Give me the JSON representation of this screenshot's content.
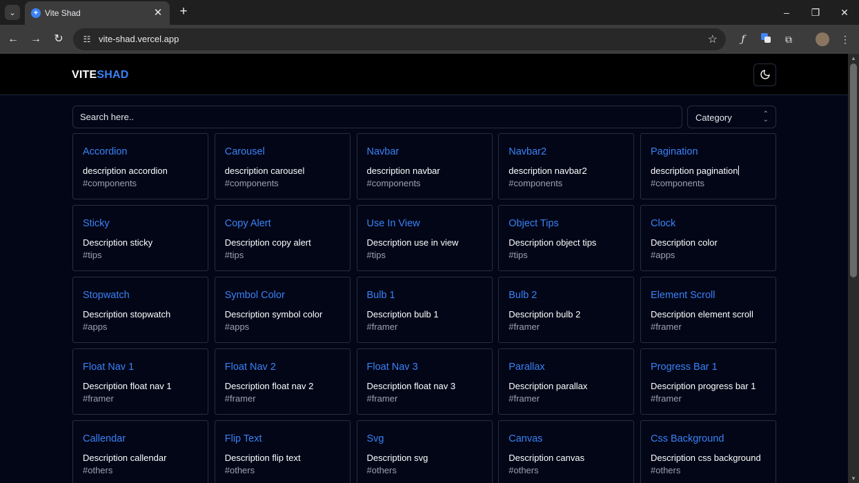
{
  "browser": {
    "tab_title": "Vite Shad",
    "url": "vite-shad.vercel.app",
    "icons": [
      "tab-list-icon",
      "favicon-icon",
      "close-icon",
      "new-tab-icon",
      "minimize-icon",
      "restore-icon",
      "window-close-icon",
      "back-icon",
      "forward-icon",
      "reload-icon",
      "site-info-icon",
      "star-icon",
      "function-icon",
      "translate-icon",
      "extensions-icon",
      "profile-avatar",
      "menu-icon"
    ]
  },
  "header": {
    "logo_part1": "VITE",
    "logo_part2": "SHAD",
    "theme_icon": "moon-icon"
  },
  "search": {
    "placeholder": "Search here.."
  },
  "category": {
    "label": "Category"
  },
  "cards": [
    {
      "title": "Accordion",
      "desc": "description accordion",
      "tag": "#components"
    },
    {
      "title": "Carousel",
      "desc": "description carousel",
      "tag": "#components"
    },
    {
      "title": "Navbar",
      "desc": "description navbar",
      "tag": "#components"
    },
    {
      "title": "Navbar2",
      "desc": "description navbar2",
      "tag": "#components"
    },
    {
      "title": "Pagination",
      "desc": "description pagination",
      "tag": "#components"
    },
    {
      "title": "Sticky",
      "desc": "Description sticky",
      "tag": "#tips"
    },
    {
      "title": "Copy Alert",
      "desc": "Description copy alert",
      "tag": "#tips"
    },
    {
      "title": "Use In View",
      "desc": "Description use in view",
      "tag": "#tips"
    },
    {
      "title": "Object Tips",
      "desc": "Description object tips",
      "tag": "#tips"
    },
    {
      "title": "Clock",
      "desc": "Description color",
      "tag": "#apps"
    },
    {
      "title": "Stopwatch",
      "desc": "Description stopwatch",
      "tag": "#apps"
    },
    {
      "title": "Symbol Color",
      "desc": "Description symbol color",
      "tag": "#apps"
    },
    {
      "title": "Bulb 1",
      "desc": "Description bulb 1",
      "tag": "#framer"
    },
    {
      "title": "Bulb 2",
      "desc": "Description bulb 2",
      "tag": "#framer"
    },
    {
      "title": "Element Scroll",
      "desc": "Description element scroll",
      "tag": "#framer"
    },
    {
      "title": "Float Nav 1",
      "desc": "Description float nav 1",
      "tag": "#framer"
    },
    {
      "title": "Float Nav 2",
      "desc": "Description float nav 2",
      "tag": "#framer"
    },
    {
      "title": "Float Nav 3",
      "desc": "Description float nav 3",
      "tag": "#framer"
    },
    {
      "title": "Parallax",
      "desc": "Description parallax",
      "tag": "#framer"
    },
    {
      "title": "Progress Bar 1",
      "desc": "Description progress bar 1",
      "tag": "#framer"
    },
    {
      "title": "Callendar",
      "desc": "Description callendar",
      "tag": "#others"
    },
    {
      "title": "Flip Text",
      "desc": "Description flip text",
      "tag": "#others"
    },
    {
      "title": "Svg",
      "desc": "Description svg",
      "tag": "#others"
    },
    {
      "title": "Canvas",
      "desc": "Description canvas",
      "tag": "#others"
    },
    {
      "title": "Css Background",
      "desc": "Description css background",
      "tag": "#others"
    }
  ],
  "colors": {
    "accent": "#3b82f6",
    "background": "#020617",
    "border": "#27303f"
  }
}
